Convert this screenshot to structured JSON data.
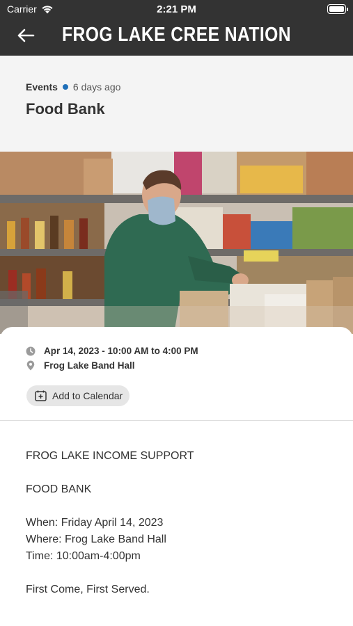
{
  "status_bar": {
    "carrier": "Carrier",
    "time": "2:21 PM"
  },
  "app_bar": {
    "title": "FROG LAKE CREE NATION",
    "back_icon": "arrow-left-icon",
    "background": "#333333"
  },
  "post": {
    "category": "Events",
    "age": "6 days ago",
    "title": "Food Bank",
    "accent": "#1f6fb8"
  },
  "event": {
    "datetime": "Apr 14, 2023 - 10:00 AM to 4:00 PM",
    "location": "Frog Lake Band Hall",
    "add_to_calendar_label": "Add to Calendar"
  },
  "description": {
    "line1": "FROG LAKE INCOME SUPPORT",
    "line2": "FOOD BANK",
    "line3": "When: Friday April 14, 2023",
    "line4": "Where: Frog Lake Band Hall",
    "line5": "Time: 10:00am-4:00pm",
    "line6": "First Come, First Served."
  }
}
